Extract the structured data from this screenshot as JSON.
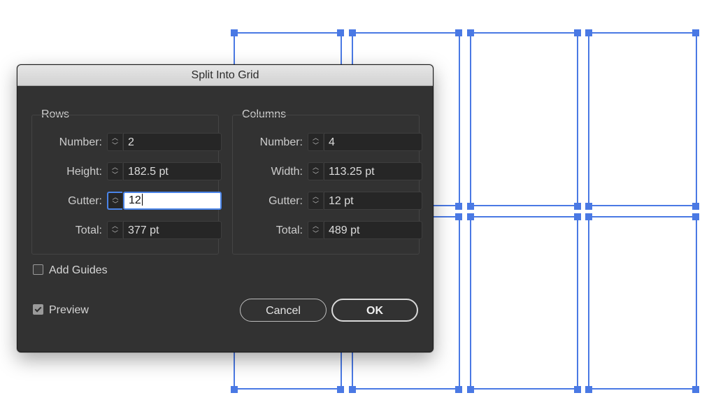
{
  "dialog": {
    "title": "Split Into Grid",
    "rows": {
      "group_label": "Rows",
      "number_label": "Number:",
      "number_value": "2",
      "height_label": "Height:",
      "height_value": "182.5 pt",
      "gutter_label": "Gutter:",
      "gutter_value": "12",
      "total_label": "Total:",
      "total_value": "377 pt"
    },
    "columns": {
      "group_label": "Columns",
      "number_label": "Number:",
      "number_value": "4",
      "width_label": "Width:",
      "width_value": "113.25 pt",
      "gutter_label": "Gutter:",
      "gutter_value": "12 pt",
      "total_label": "Total:",
      "total_value": "489 pt"
    },
    "add_guides": {
      "label": "Add Guides",
      "checked": false
    },
    "preview": {
      "label": "Preview",
      "checked": true
    },
    "cancel_label": "Cancel",
    "ok_label": "OK"
  },
  "stepper_glyphs": {
    "up": "︿",
    "down": "﹀"
  },
  "colors": {
    "selection_blue": "#4a79e4",
    "dialog_bg": "#323232",
    "focus_ring": "#4a84e8"
  }
}
